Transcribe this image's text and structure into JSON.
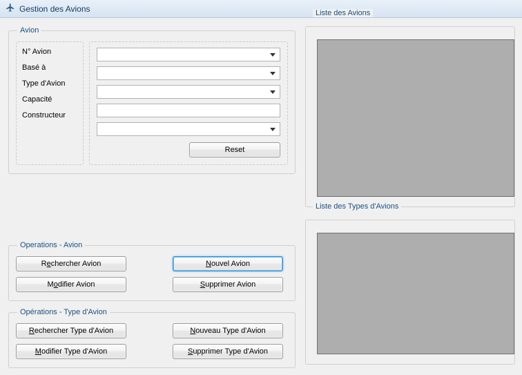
{
  "title": "Gestion des Avions",
  "avion": {
    "legend": "Avion",
    "labels": {
      "num": "N° Avion",
      "base": "Basé à",
      "type": "Type d'Avion",
      "capacite": "Capacité",
      "constructeur": "Constructeur"
    },
    "values": {
      "num": "",
      "base": "",
      "type": "",
      "capacite": "",
      "constructeur": ""
    },
    "reset": "Reset"
  },
  "ops_avion": {
    "legend": "Operations - Avion",
    "rechercher_pre": "R",
    "rechercher_u": "e",
    "rechercher_post": "chercher Avion",
    "modifier_pre": "M",
    "modifier_u": "o",
    "modifier_post": "difier Avion",
    "nouvel_pre": "",
    "nouvel_u": "N",
    "nouvel_post": "ouvel Avion",
    "supprimer_pre": "",
    "supprimer_u": "S",
    "supprimer_post": "upprimer Avion"
  },
  "ops_type": {
    "legend": "Opérations - Type d'Avion",
    "rechercher_pre": "",
    "rechercher_u": "R",
    "rechercher_post": "echercher Type d'Avion",
    "modifier_pre": "",
    "modifier_u": "M",
    "modifier_post": "odifier Type d'Avion",
    "nouveau_pre": "",
    "nouveau_u": "N",
    "nouveau_post": "ouveau Type d'Avion",
    "supprimer_pre": "",
    "supprimer_u": "S",
    "supprimer_post": "upprimer Type d'Avion"
  },
  "lists": {
    "avions_title": "Liste des Avions",
    "types_title": "Liste des Types d'Avions"
  }
}
